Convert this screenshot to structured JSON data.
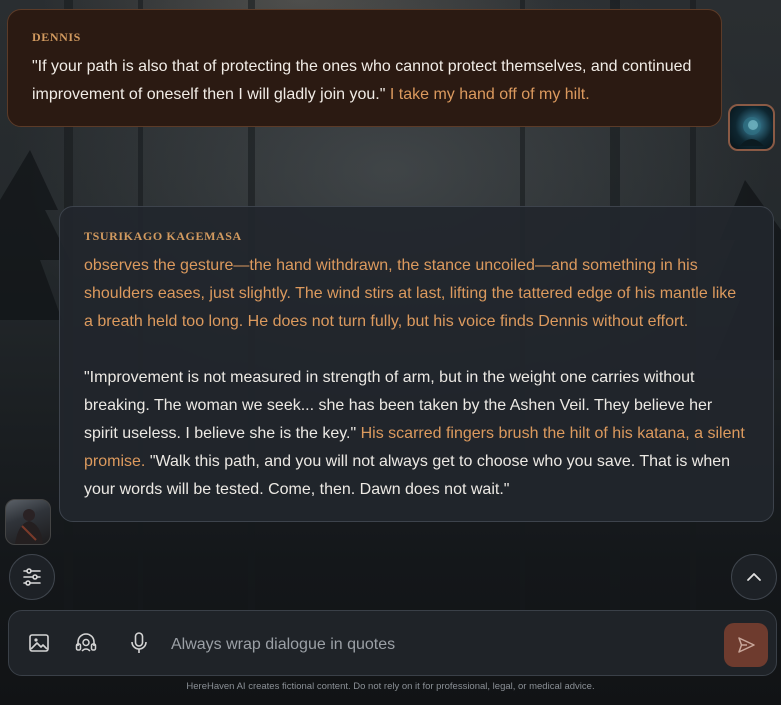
{
  "chat": {
    "user_message": {
      "speaker": "DENNIS",
      "dialogue": "\"If your path is also that of protecting the ones who cannot protect themselves, and continued improvement of oneself then I will gladly join you.\"",
      "action": "I take my hand off of my hilt."
    },
    "ai_message": {
      "speaker": "TSURIKAGO KAGEMASA",
      "action_1": "observes the gesture—the hand withdrawn, the stance uncoiled—and something in his shoulders eases, just slightly. The wind stirs at last, lifting the tattered edge of his mantle like a breath held too long. He does not turn fully, but his voice finds Dennis without effort.",
      "dialogue_1": "\"Improvement is not measured in strength of arm, but in the weight one carries without breaking. The woman we seek... she has been taken by the Ashen Veil. They believe her spirit useless. I believe she is the key.\"",
      "action_2": "His scarred fingers brush the hilt of his katana, a silent promise.",
      "dialogue_2": "\"Walk this path, and you will not always get to choose who you save. That is when your words will be tested. Come, then. Dawn does not wait.\""
    }
  },
  "composer": {
    "placeholder": "Always wrap dialogue in quotes",
    "icons": [
      "image-icon",
      "voice-chat-icon",
      "microphone-icon",
      "send-icon"
    ]
  },
  "controls": {
    "settings_icon": "sliders-icon",
    "scroll_icon": "chevron-up-icon"
  },
  "footer": {
    "disclaimer": "HereHaven AI creates fictional content. Do not rely on it for professional, legal, or medical advice."
  },
  "colors": {
    "accent": "#dc9a5e",
    "user_bubble": "#2b1a12",
    "ai_bubble": "#22262d",
    "send_button": "#6e3b2e"
  }
}
